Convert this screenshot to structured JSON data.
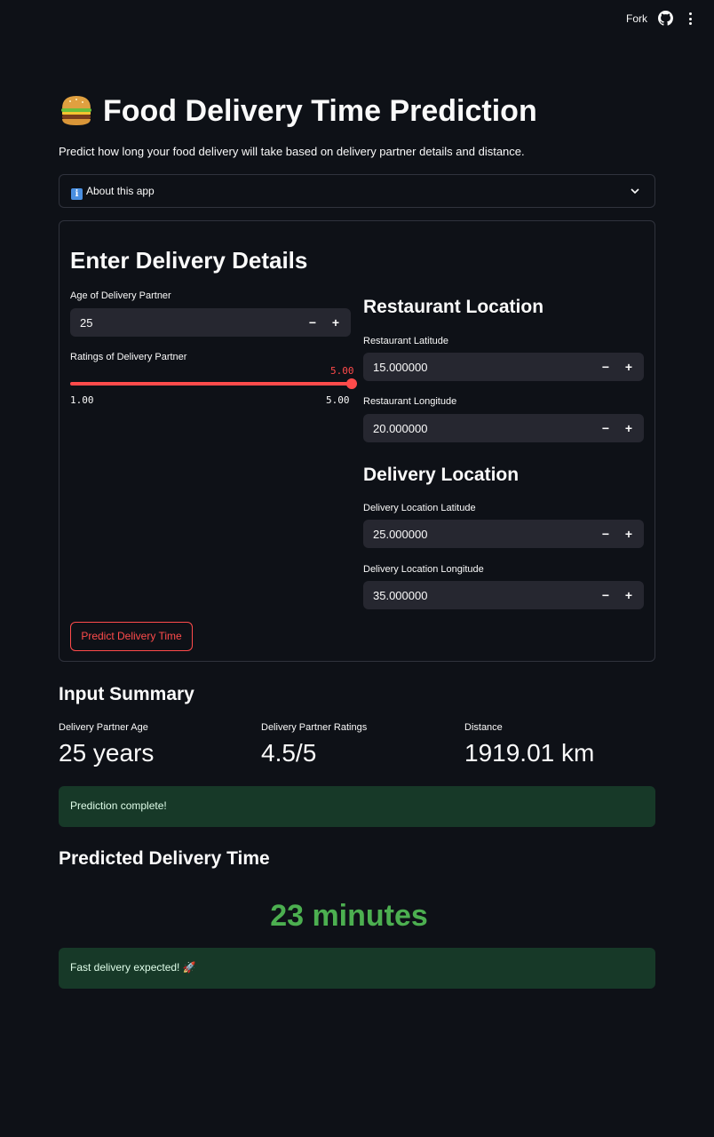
{
  "header": {
    "fork_label": "Fork",
    "github_icon": "github-icon",
    "menu_icon": "kebab-menu-icon"
  },
  "page": {
    "title": "Food Delivery Time Prediction",
    "title_emoji": "burger-emoji",
    "subtitle": "Predict how long your food delivery will take based on delivery partner details and distance."
  },
  "about": {
    "label": "About this app",
    "icon": "info-icon"
  },
  "form": {
    "heading": "Enter Delivery Details",
    "age": {
      "label": "Age of Delivery Partner",
      "value": "25"
    },
    "ratings": {
      "label": "Ratings of Delivery Partner",
      "value": "5.00",
      "min": "1.00",
      "max": "5.00",
      "fraction": 1.0
    },
    "restaurant": {
      "heading": "Restaurant Location",
      "lat_label": "Restaurant Latitude",
      "lat_value": "15.000000",
      "lon_label": "Restaurant Longitude",
      "lon_value": "20.000000"
    },
    "delivery": {
      "heading": "Delivery Location",
      "lat_label": "Delivery Location Latitude",
      "lat_value": "25.000000",
      "lon_label": "Delivery Location Longitude",
      "lon_value": "35.000000"
    },
    "stepper_minus": "−",
    "stepper_plus": "+",
    "predict_button": "Predict Delivery Time"
  },
  "summary": {
    "heading": "Input Summary",
    "metrics": [
      {
        "label": "Delivery Partner Age",
        "value": "25 years"
      },
      {
        "label": "Delivery Partner Ratings",
        "value": "4.5/5"
      },
      {
        "label": "Distance",
        "value": "1919.01 km"
      }
    ]
  },
  "status": {
    "message": "Prediction complete!"
  },
  "result": {
    "heading": "Predicted Delivery Time",
    "value": "23 minutes",
    "note": "Fast delivery expected! 🚀"
  },
  "colors": {
    "background": "#0e1117",
    "accent": "#ff4b4b",
    "success_bg": "#173928",
    "result_green": "#4caf50"
  }
}
